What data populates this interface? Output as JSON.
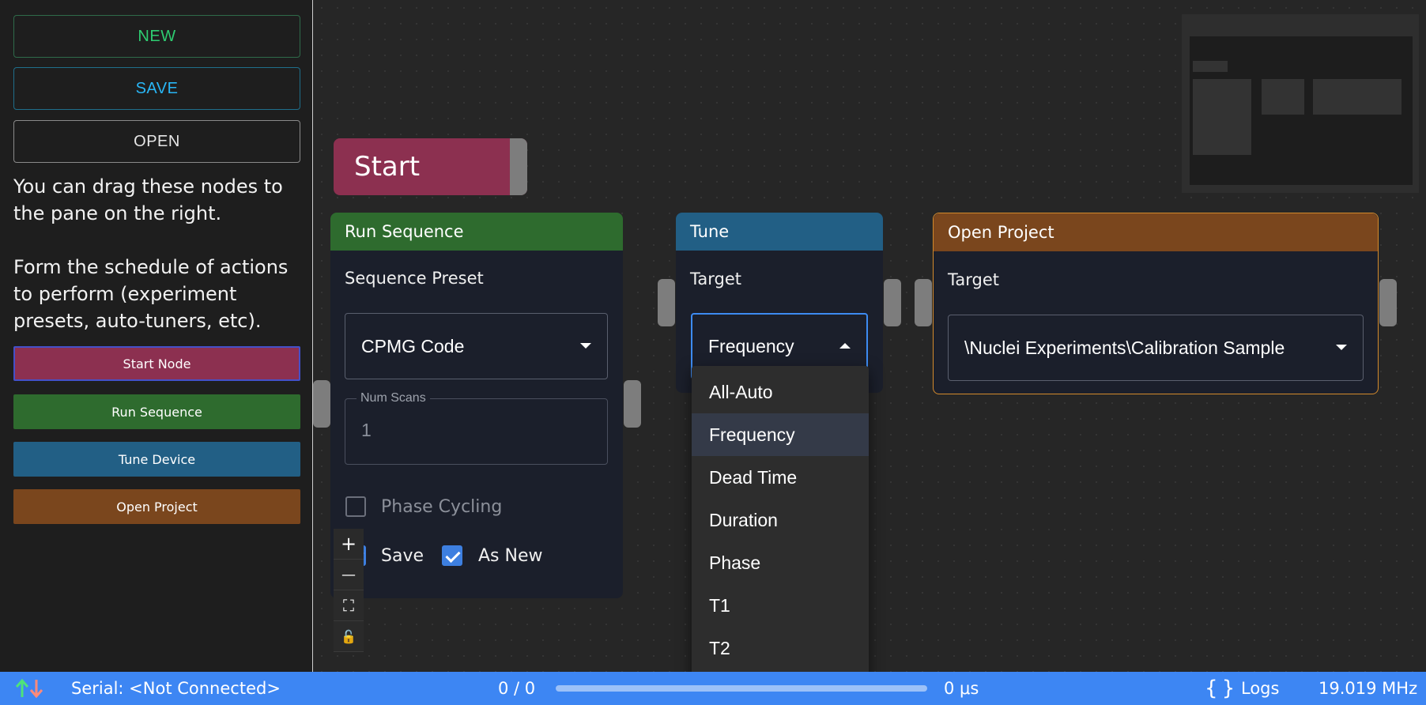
{
  "sidebar": {
    "buttons": {
      "new": "NEW",
      "save": "SAVE",
      "open": "OPEN"
    },
    "hint1": "You can drag these nodes to the pane on the right.",
    "hint2": "Form the schedule of actions to perform (experiment presets, auto-tuners, etc).",
    "node_palette": [
      "Start Node",
      "Run Sequence",
      "Tune Device",
      "Open Project"
    ]
  },
  "canvas": {
    "start_node": {
      "label": "Start"
    },
    "run_sequence": {
      "title": "Run Sequence",
      "preset_label": "Sequence Preset",
      "preset_value": "CPMG Code",
      "num_scans_label": "Num Scans",
      "num_scans_value": "1",
      "phase_cycling_label": "Phase Cycling",
      "phase_cycling_checked": false,
      "save_label": "Save",
      "save_checked": true,
      "as_new_label": "As New",
      "as_new_checked": true
    },
    "tune": {
      "title": "Tune",
      "target_label": "Target",
      "target_value": "Frequency",
      "options": [
        "All-Auto",
        "Frequency",
        "Dead Time",
        "Duration",
        "Phase",
        "T1",
        "T2"
      ],
      "selected_option": "Frequency"
    },
    "open_project": {
      "title": "Open Project",
      "target_label": "Target",
      "target_value": "\\Nuclei Experiments\\Calibration Sample"
    },
    "controls": {
      "zoom_in": "+",
      "zoom_out": "—",
      "fit_view": "⛶",
      "lock": "🔓"
    }
  },
  "statusbar": {
    "serial": "Serial: <Not Connected>",
    "progress_text": "0 / 0",
    "progress_fraction": 0.0,
    "time": "0 μs",
    "logs_label": "Logs",
    "frequency": "19.019 MHz",
    "colors": {
      "up_arrow": "#4ee37a",
      "down_arrow": "#ff8a7a"
    }
  },
  "colors": {
    "start": "#8c3050",
    "run_sequence": "#2e6b2e",
    "tune": "#225f85",
    "open_project": "#7a461d",
    "status_bar": "#3d86f3"
  }
}
